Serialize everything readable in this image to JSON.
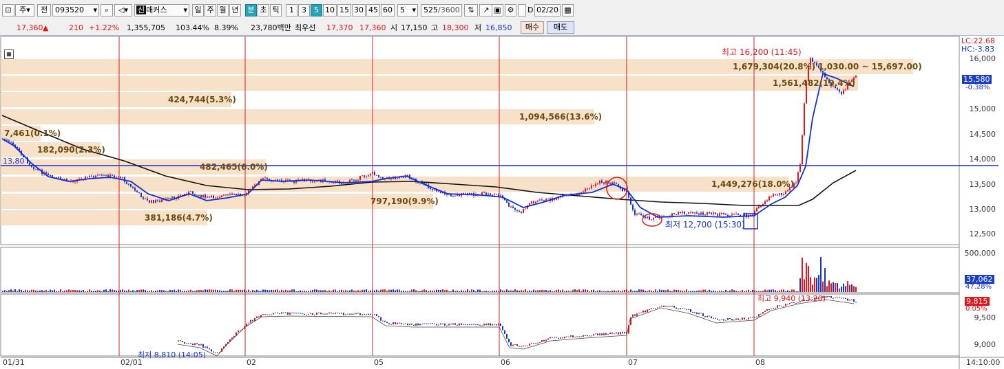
{
  "toolbar": {
    "mode1": "주",
    "mode2": "전",
    "code": "093520",
    "credit_badge": "신",
    "stock_name": "매커스",
    "period_buttons": [
      "일",
      "주",
      "월",
      "년",
      "분",
      "초",
      "틱"
    ],
    "interval_buttons": [
      "1",
      "3",
      "5",
      "10",
      "15",
      "30",
      "45",
      "60"
    ],
    "count_value": "5",
    "range_value": "525",
    "range_total": "/3600",
    "d_label": "D",
    "date_value": "02/20"
  },
  "quote": {
    "price": "17,360",
    "change_arrow": "▲",
    "change": "210",
    "change_pct": "+1.22%",
    "volume": "1,355,705",
    "vol_ratio": "103.44%",
    "turnover": "8.39%",
    "amount": "23,780백만",
    "best_label": "최우선",
    "best_ask": "17,370",
    "best_bid": "17,360",
    "open_label": "시",
    "open": "17,150",
    "high_label": "고",
    "high": "18,300",
    "low_label": "저",
    "low": "16,850",
    "buy_label": "매수",
    "sell_label": "매도"
  },
  "price_panel": {
    "top_right_1": "LC:22.68",
    "top_right_2": "HC:-3.83",
    "current_price": "15,580",
    "current_pct": "-0.38%",
    "left_price": "13,80",
    "high_note": "최고 16,200 (11:45)",
    "low_note": "최저 12,700 (15:30)",
    "range_note": "1,030.00 ~ 15,697.00)",
    "axis_labels": [
      "16,000",
      "15,500",
      "15,000",
      "14,500",
      "14,000",
      "13,500",
      "13,000",
      "12,500"
    ],
    "volume_profile": [
      "1,679,304(20.8%)",
      "1,561,482(19.4%)",
      "424,744(5.3%)",
      "1,094,566(13.6%)",
      "7,461(0.1%)",
      "182,090(2.3%)",
      "482,465(6.0%)",
      "1,449,276(18.0%)",
      "797,190(9.9%)",
      "381,186(4.7%)"
    ]
  },
  "volume_panel": {
    "axis_top": "500,000",
    "current": "37,062",
    "current_pct": "47.28%"
  },
  "indicator_panel": {
    "high_note": "최고 9,940 (13:20)",
    "low_note": "최저 8,810 (14:05)",
    "current": "9,815",
    "current_pct": "0.05%",
    "axis_labels": [
      "9,500",
      "9,000"
    ]
  },
  "x_axis": {
    "labels": [
      "01/31",
      "02/01",
      "02",
      "05",
      "06",
      "07",
      "08"
    ],
    "time": "14:10:00"
  },
  "colors": {
    "band": "#f6dcc0",
    "ma_blue": "#1230d8",
    "ma_black": "#111111",
    "day_line": "#d01818",
    "up": "#e5141a",
    "down": "#1433d6"
  }
}
